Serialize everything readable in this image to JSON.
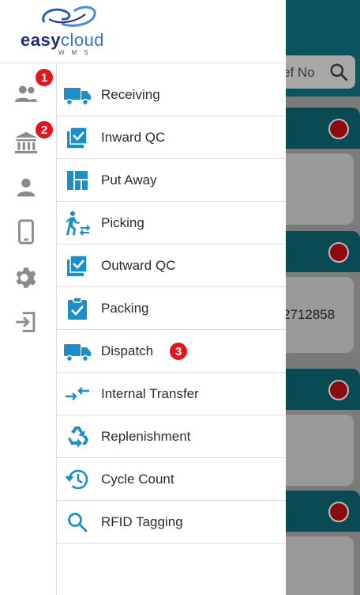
{
  "logo": {
    "brand_easy": "easy",
    "brand_cloud": "cloud",
    "subtitle": "WMS"
  },
  "background": {
    "search_placeholder": "ef No",
    "visible_number": "2712858"
  },
  "rail": [
    {
      "name": "users",
      "icon": "users-icon"
    },
    {
      "name": "bank",
      "icon": "bank-icon"
    },
    {
      "name": "profile",
      "icon": "person-icon"
    },
    {
      "name": "device",
      "icon": "phone-icon"
    },
    {
      "name": "settings",
      "icon": "gear-icon"
    },
    {
      "name": "logout",
      "icon": "logout-icon"
    }
  ],
  "badges": {
    "one": "1",
    "two": "2",
    "three": "3"
  },
  "menu": [
    {
      "label": "Receiving",
      "icon": "truck-icon"
    },
    {
      "label": "Inward QC",
      "icon": "checklist-icon"
    },
    {
      "label": "Put Away",
      "icon": "layout-icon"
    },
    {
      "label": "Picking",
      "icon": "walking-person-icon"
    },
    {
      "label": "Outward QC",
      "icon": "checklist-icon"
    },
    {
      "label": "Packing",
      "icon": "clipboard-check-icon"
    },
    {
      "label": "Dispatch",
      "icon": "truck-icon"
    },
    {
      "label": "Internal Transfer",
      "icon": "transfer-arrows-icon"
    },
    {
      "label": "Replenishment",
      "icon": "recycle-icon"
    },
    {
      "label": "Cycle Count",
      "icon": "history-icon"
    },
    {
      "label": "RFID Tagging",
      "icon": "search-icon"
    }
  ],
  "colors": {
    "accent": "#1e8fc6",
    "badge": "#e2161b",
    "brand": "#1f2c7a"
  }
}
